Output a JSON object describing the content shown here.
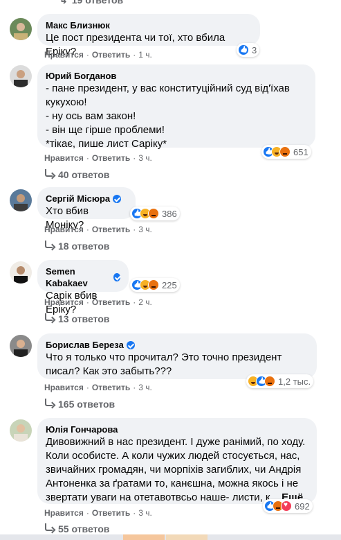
{
  "top_replies": "19 ответов",
  "labels": {
    "like": "Нравится",
    "reply": "Ответить",
    "sep": "·"
  },
  "comments": [
    {
      "author": "Макс Близнюк",
      "verified": false,
      "text": "Це пост президента чи тої, хто вбила Еріку?",
      "time": "1 ч.",
      "reactions": [
        "like"
      ],
      "reaction_count": "3",
      "replies": ""
    },
    {
      "author": "Юрий Богданов",
      "verified": false,
      "text": "- пане президент, у вас конституційний суд від'їхав кукухою!\n- ну ось вам закон!\n- він ще гірше проблеми!\n*тікає, пише лист Саріку*",
      "time": "3 ч.",
      "reactions": [
        "like",
        "haha",
        "angry"
      ],
      "reaction_count": "651",
      "replies": "40 ответов"
    },
    {
      "author": "Сергій Місюра",
      "verified": true,
      "text": "Хто вбив Моніку?",
      "time": "3 ч.",
      "reactions": [
        "like",
        "haha",
        "angry"
      ],
      "reaction_count": "386",
      "replies": "18 ответов"
    },
    {
      "author": "Semen Kabakaev",
      "verified": true,
      "text": "Сарік вбив Еріку?",
      "time": "2 ч.",
      "reactions": [
        "like",
        "haha",
        "angry"
      ],
      "reaction_count": "225",
      "replies": "13 ответов"
    },
    {
      "author": "Борислав Береза",
      "verified": true,
      "text": "Что я только что прочитал? Это точно президент писал? Как это забыть???",
      "time": "3 ч.",
      "reactions": [
        "haha",
        "like",
        "angry"
      ],
      "reaction_count": "1,2 тыс.",
      "replies": "165 ответов"
    },
    {
      "author": "Юлія Гончарова",
      "verified": false,
      "text": "Дивовижний в нас президент. І дуже ранімий, по ходу. Коли особисте. А коли чужих людей стосується, нас, звичайних громадян, чи морпіхів загиблих, чи Андрія Антоненка за ґратами то, канєшна, можна якось і не звертати уваги на отетавотвсьо наше- листи, к...",
      "more": "Ещё",
      "time": "3 ч.",
      "reactions": [
        "like",
        "angry",
        "love"
      ],
      "reaction_count": "692",
      "replies": "55 ответов"
    }
  ],
  "colors": {
    "link_grey": "#65676b",
    "bubble": "#f0f2f5",
    "accent": "#1877f2"
  }
}
